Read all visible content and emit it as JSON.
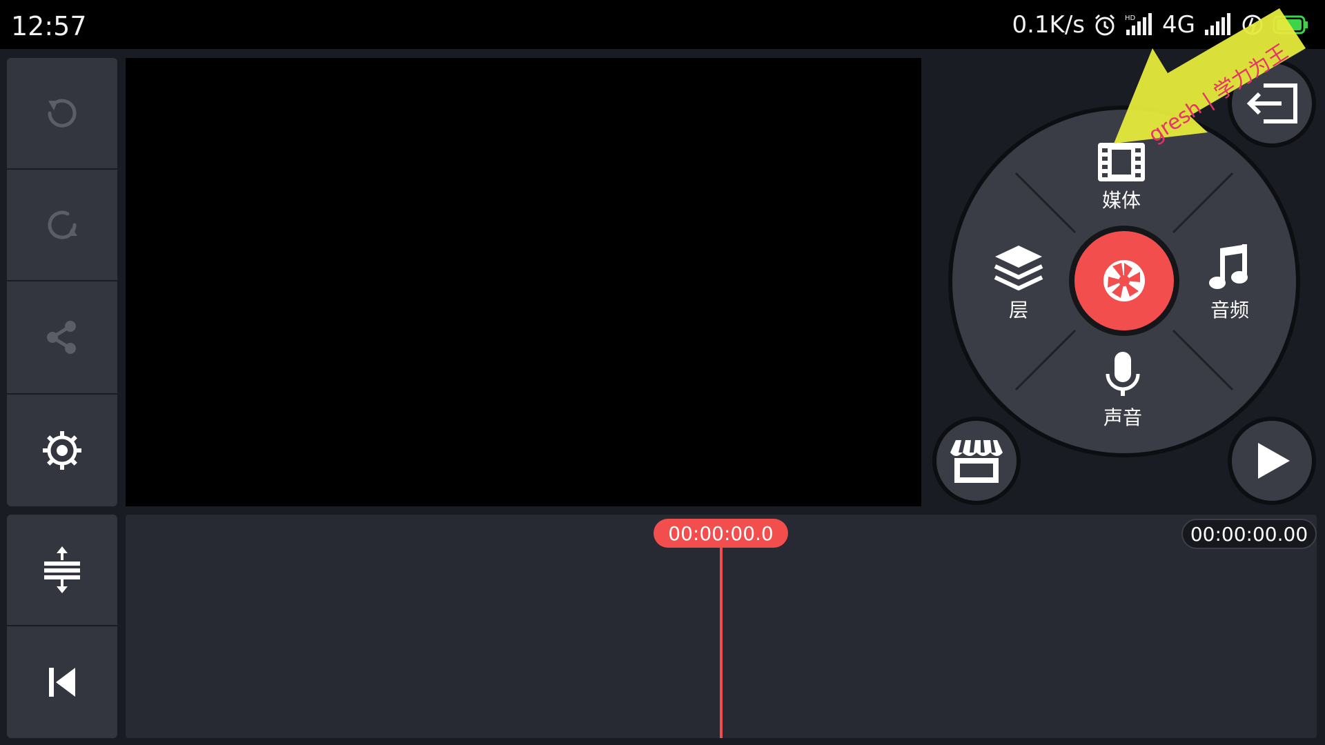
{
  "status_bar": {
    "time": "12:57",
    "speed": "0.1K/s",
    "network": "4G",
    "hd_label": "HD"
  },
  "sidebar": {
    "items": [
      {
        "name": "undo",
        "icon": "undo-icon"
      },
      {
        "name": "redo",
        "icon": "redo-icon"
      },
      {
        "name": "share",
        "icon": "share-icon"
      },
      {
        "name": "settings",
        "icon": "gear-icon"
      },
      {
        "name": "track-height",
        "icon": "expand-tracks-icon"
      },
      {
        "name": "go-to-start",
        "icon": "skip-to-start-icon"
      }
    ]
  },
  "radial_menu": {
    "media_label": "媒体",
    "layer_label": "层",
    "audio_label": "音频",
    "voice_label": "声音",
    "center_icon": "camera-shutter-icon"
  },
  "timeline": {
    "playhead_time": "00:00:00.0",
    "duration": "00:00:00.00"
  },
  "watermark": {
    "text": "gresh | 学力为王"
  },
  "colors": {
    "accent": "#f24e4e",
    "panel": "#33363e",
    "background": "#1a1c23",
    "arrow": "#e6ea3c"
  }
}
